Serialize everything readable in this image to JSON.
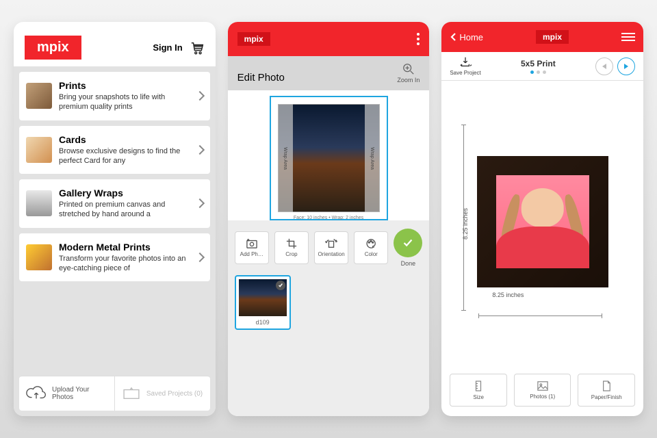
{
  "brand": "mpix",
  "screen1": {
    "signIn": "Sign In",
    "categories": [
      {
        "title": "Prints",
        "desc": "Bring your snapshots to life with premium quality prints"
      },
      {
        "title": "Cards",
        "desc": "Browse exclusive designs to find the perfect Card for any"
      },
      {
        "title": "Gallery Wraps",
        "desc": "Printed on premium canvas and stretched by hand around a"
      },
      {
        "title": "Modern Metal Prints",
        "desc": "Transform your favorite photos into an eye-catching piece of"
      }
    ],
    "upload": "Upload Your Photos",
    "saved": "Saved Projects (0)"
  },
  "screen2": {
    "title": "Edit Photo",
    "zoom": "Zoom In",
    "wrapLabel": "Wrap Area",
    "faceLabel": "Face: 10 inches • Wrap: 2 inches",
    "tools": {
      "add": "Add Ph…",
      "crop": "Crop",
      "orient": "Orientation",
      "color": "Color"
    },
    "done": "Done",
    "thumb": "d109"
  },
  "screen3": {
    "home": "Home",
    "save": "Save Project",
    "title": "5x5 Print",
    "dimV": "8.25 inches",
    "dimH": "8.25 inches",
    "footer": {
      "size": "Size",
      "photos": "Photos (1)",
      "paper": "Paper/Finish"
    }
  }
}
